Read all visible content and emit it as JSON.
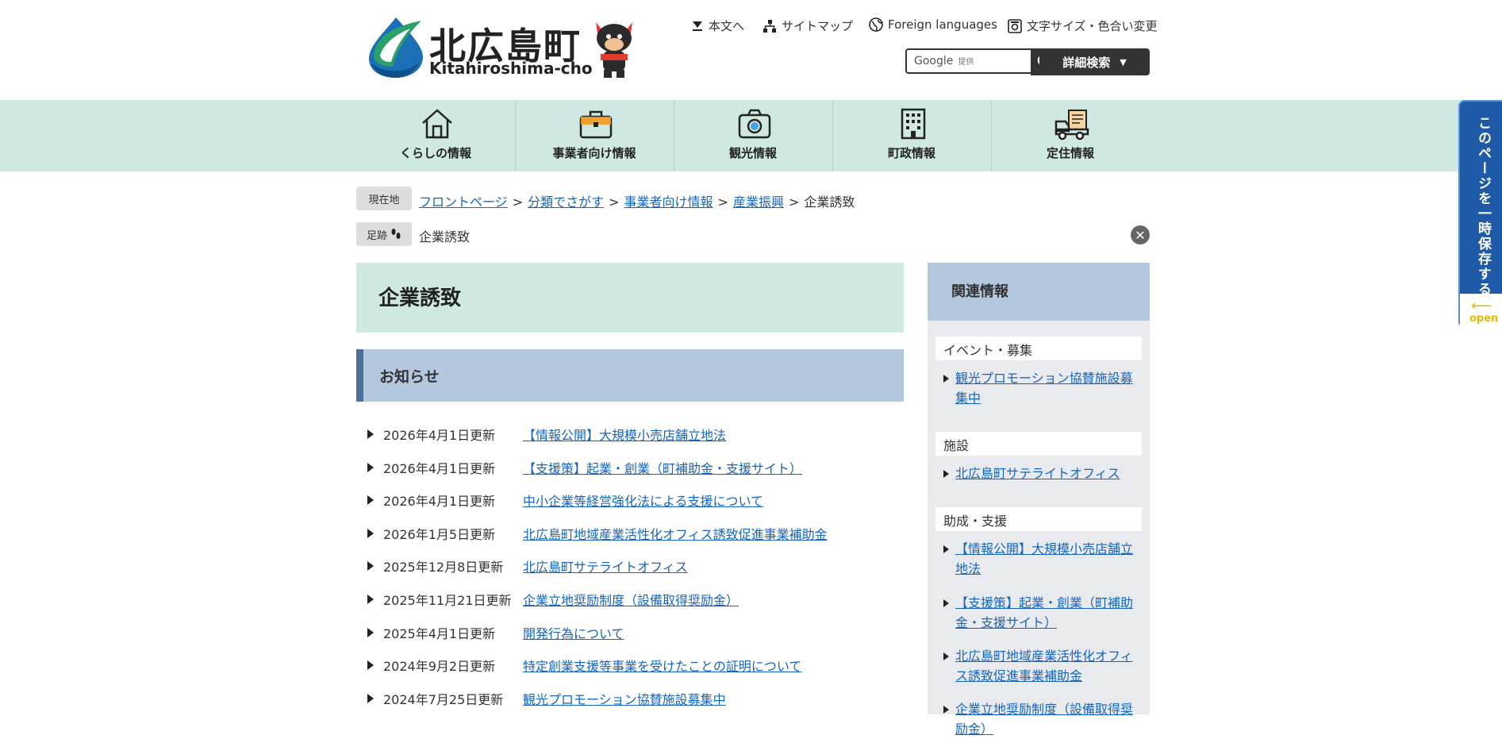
{
  "header": {
    "logo_title": "北広島町",
    "logo_roman": "Kitahiroshima-cho",
    "utility": {
      "skip": "本文へ",
      "sitemap": "サイトマップ",
      "foreign": "Foreign languages",
      "font_color": "文字サイズ・色合い変更"
    },
    "search": {
      "google_label": "Google",
      "google_small": "提供",
      "advanced_label": "詳細検索"
    }
  },
  "nav": [
    {
      "label": "くらしの情報",
      "icon": "house-icon"
    },
    {
      "label": "事業者向け情報",
      "icon": "briefcase-icon"
    },
    {
      "label": "観光情報",
      "icon": "camera-icon"
    },
    {
      "label": "町政情報",
      "icon": "building-icon"
    },
    {
      "label": "定住情報",
      "icon": "moving-truck-icon"
    }
  ],
  "breadcrumb": {
    "here_tag": "現在地",
    "items": [
      "フロントページ",
      "分類でさがす",
      "事業者向け情報",
      "産業振興"
    ],
    "current": "企業誘致",
    "sep": ">"
  },
  "footprint": {
    "tag": "足跡",
    "item": "企業誘致"
  },
  "main": {
    "title": "企業誘致",
    "news_heading": "お知らせ",
    "news": [
      {
        "date": "2026年4月1日更新",
        "title": "【情報公開】大規模小売店舗立地法"
      },
      {
        "date": "2026年4月1日更新",
        "title": "【支援策】起業・創業（町補助金・支援サイト）"
      },
      {
        "date": "2026年4月1日更新",
        "title": "中小企業等経営強化法による支援について"
      },
      {
        "date": "2026年1月5日更新",
        "title": "北広島町地域産業活性化オフィス誘致促進事業補助金"
      },
      {
        "date": "2025年12月8日更新",
        "title": "北広島町サテライトオフィス"
      },
      {
        "date": "2025年11月21日更新",
        "title": "企業立地奨励制度（設備取得奨励金）"
      },
      {
        "date": "2025年4月1日更新",
        "title": "開発行為について"
      },
      {
        "date": "2024年9月2日更新",
        "title": "特定創業支援等事業を受けたことの証明について"
      },
      {
        "date": "2024年7月25日更新",
        "title": "観光プロモーション協賛施設募集中"
      }
    ]
  },
  "sidebar": {
    "heading": "関連情報",
    "categories": [
      {
        "name": "イベント・募集",
        "links": [
          "観光プロモーション協賛施設募集中"
        ]
      },
      {
        "name": "施設",
        "links": [
          "北広島町サテライトオフィス"
        ]
      },
      {
        "name": "助成・支援",
        "links": [
          "【情報公開】大規模小売店舗立地法",
          "【支援策】起業・創業（町補助金・支援サイト）",
          "北広島町地域産業活性化オフィス誘致促進事業補助金",
          "企業立地奨励制度（設備取得奨励金）"
        ]
      }
    ]
  },
  "save_tab": {
    "text": "このページを一時保存する",
    "open": "open"
  },
  "colors": {
    "nav_bg": "#cfe9e2",
    "section_blue": "#b3c7de",
    "accent_blue": "#1e5aa8",
    "link": "#1565c0"
  }
}
